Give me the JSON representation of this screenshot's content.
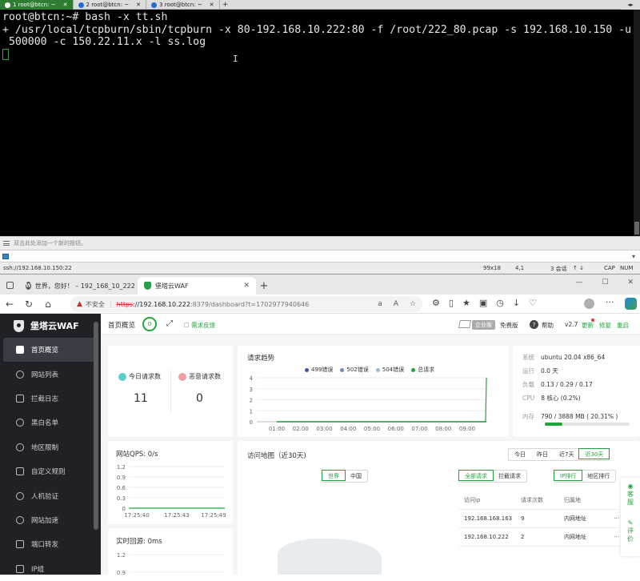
{
  "terminal": {
    "tabs": [
      {
        "label": "1 root@btcn: ~",
        "active": true
      },
      {
        "label": "2 root@btcn: ~",
        "active": false
      },
      {
        "label": "3 root@btcn: ~",
        "active": false
      }
    ],
    "lines": [
      "root@btcn:~# bash -x tt.sh",
      "+ /usr/local/tcpburn/sbin/tcpburn -x 80-192.168.10.222:80 -f /root/222_80.pcap -s 192.168.10.150 -u",
      " 500000 -c 150.22.11.x -l ss.log"
    ],
    "hint_text": "双击此处添加一个新的按钮。",
    "status": {
      "ssh": "ssh://192.168.10.150:22",
      "size": "99x18",
      "pos": "4,1",
      "sessions": "3 会话",
      "cap": "CAP",
      "num": "NUM"
    }
  },
  "browser": {
    "tabs": [
      {
        "label": "世界，您好！ – 192_168_10_222",
        "active": false
      },
      {
        "label": "堡塔云WAF",
        "active": true
      }
    ],
    "insecure_label": "不安全",
    "url_scheme": "https",
    "url_host": "://192.168.10.222",
    "url_rest": ":8379/dashboard?t=1702977940646"
  },
  "waf": {
    "brand": "堡塔云WAF",
    "nav": [
      {
        "label": "首页概览",
        "active": true
      },
      {
        "label": "网站列表"
      },
      {
        "label": "拦截日志"
      },
      {
        "label": "黑白名单"
      },
      {
        "label": "地区限制"
      },
      {
        "label": "自定义规则"
      },
      {
        "label": "人机验证"
      },
      {
        "label": "网站加速"
      },
      {
        "label": "端口转发"
      },
      {
        "label": "IP组"
      }
    ],
    "header": {
      "title": "首页概览",
      "count": "0",
      "feedback": "需求反馈",
      "enterprise": "企业版",
      "free": "免费版",
      "help": "帮助",
      "version": "v2.7",
      "update": "更新",
      "fix": "修复",
      "restart": "重启"
    },
    "stats": {
      "today_label": "今日请求数",
      "today_value": "11",
      "malicious_label": "恶意请求数",
      "malicious_value": "0"
    },
    "trend": {
      "title": "请求趋势"
    },
    "system": {
      "rows": [
        {
          "k": "系统",
          "v": "ubuntu 20.04 x86_64"
        },
        {
          "k": "运行",
          "v": "0.0 天"
        },
        {
          "k": "负载",
          "v": "0.13 / 0.29 / 0.17"
        },
        {
          "k": "CPU",
          "v": "8 核心 (0.2%)"
        },
        {
          "k": "内存",
          "v": "790 / 3888 MB ( 20.31% )"
        }
      ],
      "mem_fraction": 0.2031
    },
    "qps": {
      "title": "网站QPS: 0/s"
    },
    "backsource": {
      "title": "实时回源: 0ms"
    },
    "map": {
      "title": "访问地图（近30天)",
      "ranges": [
        "今日",
        "昨日",
        "近7天",
        "近30天"
      ],
      "scopes": [
        "世界",
        "中国"
      ],
      "filters": [
        "全部请求",
        "拦截请求"
      ],
      "rank_tabs": [
        "IP排行",
        "地区排行"
      ],
      "table_head": [
        "访问ip",
        "请求次数",
        "归属地",
        ""
      ],
      "table_rows": [
        [
          "192.168.168.163",
          "9",
          "内网地址",
          "···"
        ],
        [
          "192.168.10.222",
          "2",
          "内网地址",
          "···"
        ]
      ],
      "dock": [
        "客服",
        "评价"
      ]
    }
  },
  "chart_data": [
    {
      "type": "line",
      "title": "请求趋势",
      "x": [
        "01:00",
        "02:00",
        "03:00",
        "04:00",
        "05:00",
        "06:00",
        "07:00",
        "08:00",
        "09:00"
      ],
      "ylim": [
        0,
        4
      ],
      "yticks": [
        0,
        1,
        2,
        3,
        4
      ],
      "series": [
        {
          "name": "499错误",
          "color": "#3f51b5",
          "values": [
            0,
            0,
            0,
            0,
            0,
            0,
            0,
            0,
            0
          ]
        },
        {
          "name": "502错误",
          "color": "#6c8ebf",
          "values": [
            0,
            0,
            0,
            0,
            0,
            0,
            0,
            0,
            0
          ]
        },
        {
          "name": "504错误",
          "color": "#9fb5d8",
          "values": [
            0,
            0,
            0,
            0,
            0,
            0,
            0,
            0,
            0
          ]
        },
        {
          "name": "总请求",
          "color": "#20a53a",
          "values": [
            0,
            0,
            0,
            0,
            0,
            0,
            0,
            0,
            4
          ]
        }
      ],
      "legend": "top"
    },
    {
      "type": "line",
      "title": "网站QPS: 0/s",
      "x": [
        "17:25:40",
        "17:25:43",
        "17:25:49"
      ],
      "yticks": [
        0,
        0.3,
        0.6,
        0.9,
        1.2
      ],
      "ylim": [
        0,
        1.2
      ],
      "series": [
        {
          "color": "#20a53a",
          "values": [
            0,
            0,
            0
          ]
        }
      ]
    },
    {
      "type": "line",
      "title": "实时回源: 0ms",
      "yticks": [
        0.9,
        1.2
      ],
      "ylim": [
        0,
        1.2
      ],
      "series": []
    }
  ]
}
